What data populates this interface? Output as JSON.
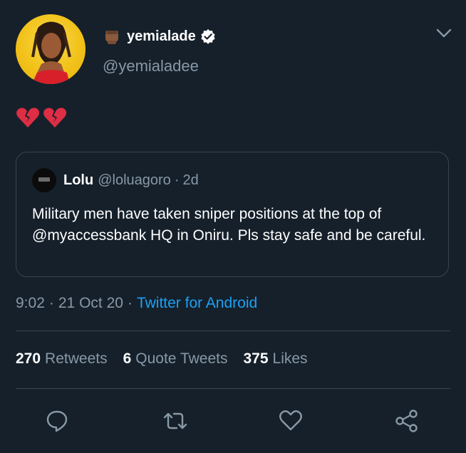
{
  "author": {
    "display_name": "yemialade",
    "handle": "@yemialadee",
    "verified": true,
    "name_emoji": "raised-fist-emoji"
  },
  "tweet": {
    "emoji": [
      "broken-heart-emoji",
      "broken-heart-emoji"
    ]
  },
  "quoted_tweet": {
    "name": "Lolu",
    "handle": "@loluagoro",
    "separator": "·",
    "time": "2d",
    "text": "Military men have taken sniper positions at the top of @myaccessbank HQ in Oniru. Pls stay safe and be careful."
  },
  "meta": {
    "time": "9:02",
    "sep1": "·",
    "date": "21 Oct 20",
    "sep2": "·",
    "source": "Twitter for Android"
  },
  "stats": {
    "retweets_count": "270",
    "retweets_label": "Retweets",
    "quotes_count": "6",
    "quotes_label": "Quote Tweets",
    "likes_count": "375",
    "likes_label": "Likes"
  },
  "actions": [
    "reply-icon",
    "retweet-icon",
    "like-icon",
    "share-icon"
  ],
  "colors": {
    "background": "#15202b",
    "secondary_text": "#8899a6",
    "link": "#1da1f2",
    "border": "#38444d",
    "broken_heart": "#dd2e44"
  }
}
